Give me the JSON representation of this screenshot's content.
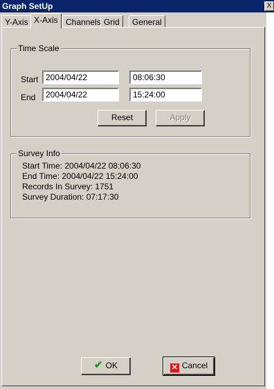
{
  "window": {
    "title": "Graph SetUp",
    "close_label": "X"
  },
  "tabs": [
    {
      "label": "Y-Axis"
    },
    {
      "label": "X-Axis",
      "active": true
    },
    {
      "label": "Channels"
    },
    {
      "label": "Grid"
    },
    {
      "label": "General"
    }
  ],
  "time_scale": {
    "title": "Time Scale",
    "start_label": "Start",
    "end_label": "End",
    "start_date": "2004/04/22",
    "start_time": "08:06:30",
    "end_date": "2004/04/22",
    "end_time": "15:24:00",
    "reset_label": "Reset",
    "apply_label": "Apply"
  },
  "survey_info": {
    "title": "Survey Info",
    "lines": [
      "Start Time: 2004/04/22 08:06:30",
      "End Time: 2004/04/22 15:24:00",
      "Records In Survey: 1751",
      "Survey Duration: 07:17:30"
    ]
  },
  "footer": {
    "ok_label": "OK",
    "cancel_label": "Cancel"
  },
  "colors": {
    "titlebar": "#0a246a",
    "dialog": "#d4d0c8",
    "ok_check": "#1e9a1e",
    "cancel_x": "#d31c1c"
  },
  "icons": {
    "ok": "check-icon",
    "cancel": "x-icon"
  }
}
